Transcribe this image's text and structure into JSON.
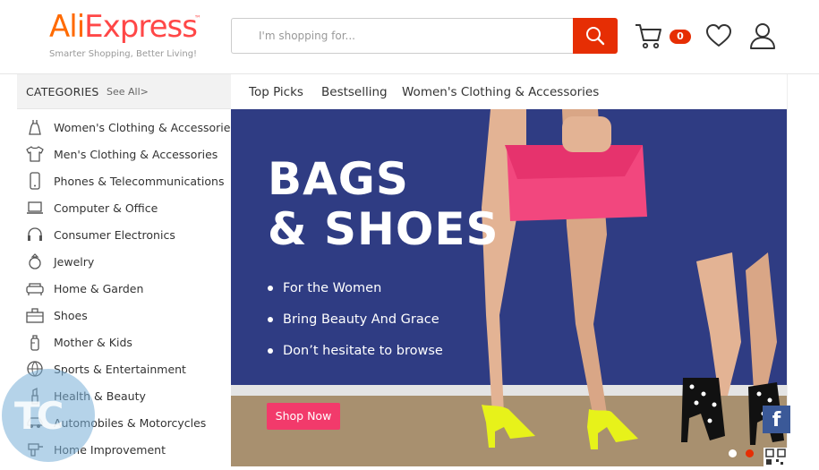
{
  "header": {
    "logo_ali": "Ali",
    "logo_express": "Express",
    "logo_tm": "™",
    "tagline": "Smarter Shopping, Better Living!",
    "search_placeholder": "I'm shopping for...",
    "cart_count": "0"
  },
  "categories": {
    "title": "CATEGORIES",
    "see_all": "See All>",
    "items": [
      {
        "label": "Women's Clothing & Accessories",
        "icon": "dress-icon"
      },
      {
        "label": "Men's Clothing & Accessories",
        "icon": "shirt-icon"
      },
      {
        "label": "Phones & Telecommunications",
        "icon": "phone-icon"
      },
      {
        "label": "Computer & Office",
        "icon": "laptop-icon"
      },
      {
        "label": "Consumer Electronics",
        "icon": "headphones-icon"
      },
      {
        "label": "Jewelry",
        "icon": "ring-icon"
      },
      {
        "label": "Home & Garden",
        "icon": "sofa-icon"
      },
      {
        "label": "Shoes",
        "icon": "shoebox-icon"
      },
      {
        "label": "Mother & Kids",
        "icon": "bottle-icon"
      },
      {
        "label": "Sports & Entertainment",
        "icon": "ball-icon"
      },
      {
        "label": "Health & Beauty",
        "icon": "lipstick-icon"
      },
      {
        "label": "Automobiles & Motorcycles",
        "icon": "car-icon"
      },
      {
        "label": "Home Improvement",
        "icon": "drill-icon"
      }
    ]
  },
  "topnav": {
    "items": [
      "Top Picks",
      "Bestselling",
      "Women's Clothing & Accessories"
    ]
  },
  "banner": {
    "title_line1": "BAGS",
    "title_line2": "& SHOES",
    "bullets": [
      "For the Women",
      "Bring Beauty And Grace",
      "Don’t hesitate to browse"
    ],
    "cta": "Shop Now",
    "active_slide": 2,
    "slide_count": 2
  },
  "social": {
    "facebook_glyph": "f"
  },
  "watermark": {
    "text": "TC"
  },
  "colors": {
    "brand_red": "#e62e04",
    "brand_orange": "#ff6a00",
    "banner_bg": "#2f3c83",
    "cta_pink": "#f23a6b",
    "bag_pink": "#f2477e",
    "shoe_yellow": "#e7f21a"
  }
}
